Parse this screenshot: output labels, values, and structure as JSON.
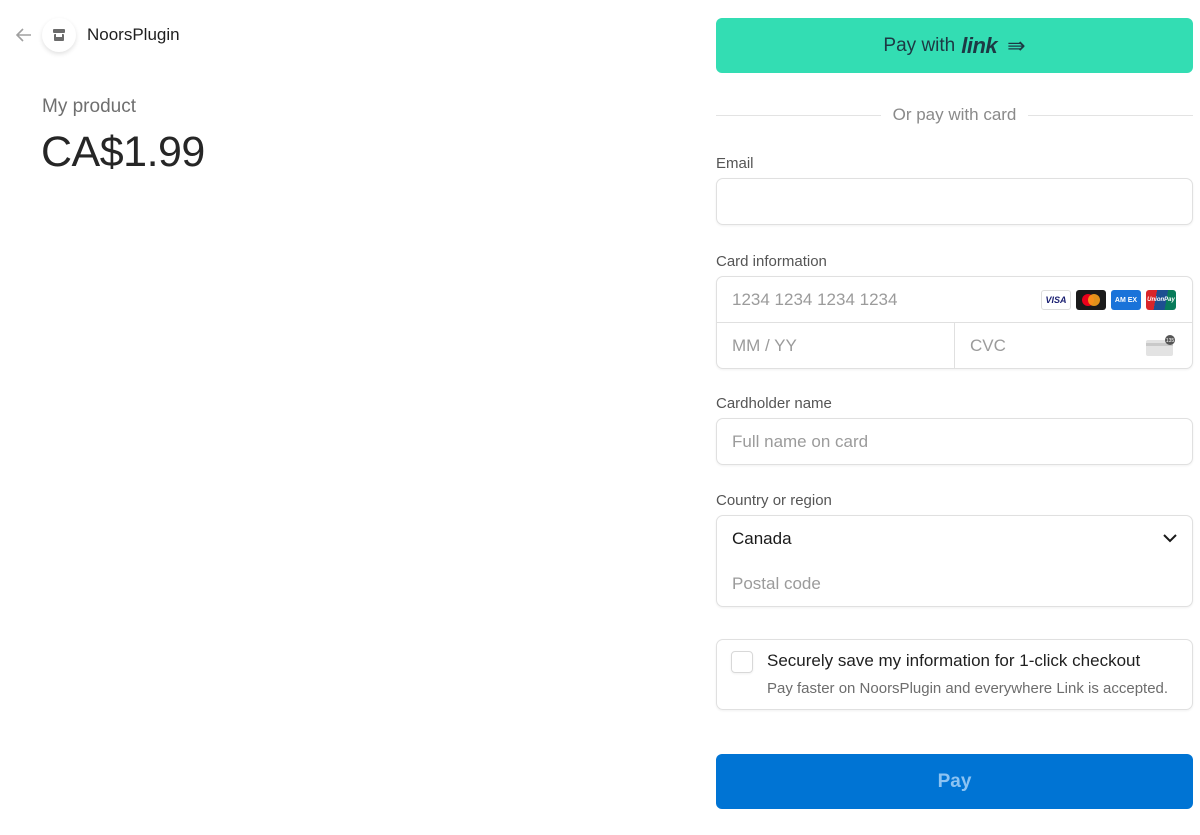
{
  "header": {
    "back_icon": "arrow-left-icon",
    "logo_icon": "store-icon",
    "brand_name": "NoorsPlugin"
  },
  "product": {
    "name": "My product",
    "price": "CA$1.99"
  },
  "checkout": {
    "link_button": {
      "prefix": "Pay with",
      "brand": "link",
      "icon": "double-arrow-right-icon",
      "color": "#33ddb3"
    },
    "divider_text": "Or pay with card",
    "email": {
      "label": "Email",
      "value": "",
      "placeholder": ""
    },
    "card": {
      "label": "Card information",
      "number_placeholder": "1234 1234 1234 1234",
      "expiry_placeholder": "MM / YY",
      "cvc_placeholder": "CVC",
      "cvc_icon_text": "135",
      "brands": [
        "VISA",
        "Mastercard",
        "AMEX",
        "UnionPay"
      ]
    },
    "cardholder": {
      "label": "Cardholder name",
      "placeholder": "Full name on card"
    },
    "country": {
      "label": "Country or region",
      "selected": "Canada",
      "postal_placeholder": "Postal code"
    },
    "save_info": {
      "checked": false,
      "title": "Securely save my information for 1-click checkout",
      "description": "Pay faster on NoorsPlugin and everywhere Link is accepted."
    },
    "pay_button": {
      "label": "Pay",
      "color": "#0074d4"
    }
  }
}
